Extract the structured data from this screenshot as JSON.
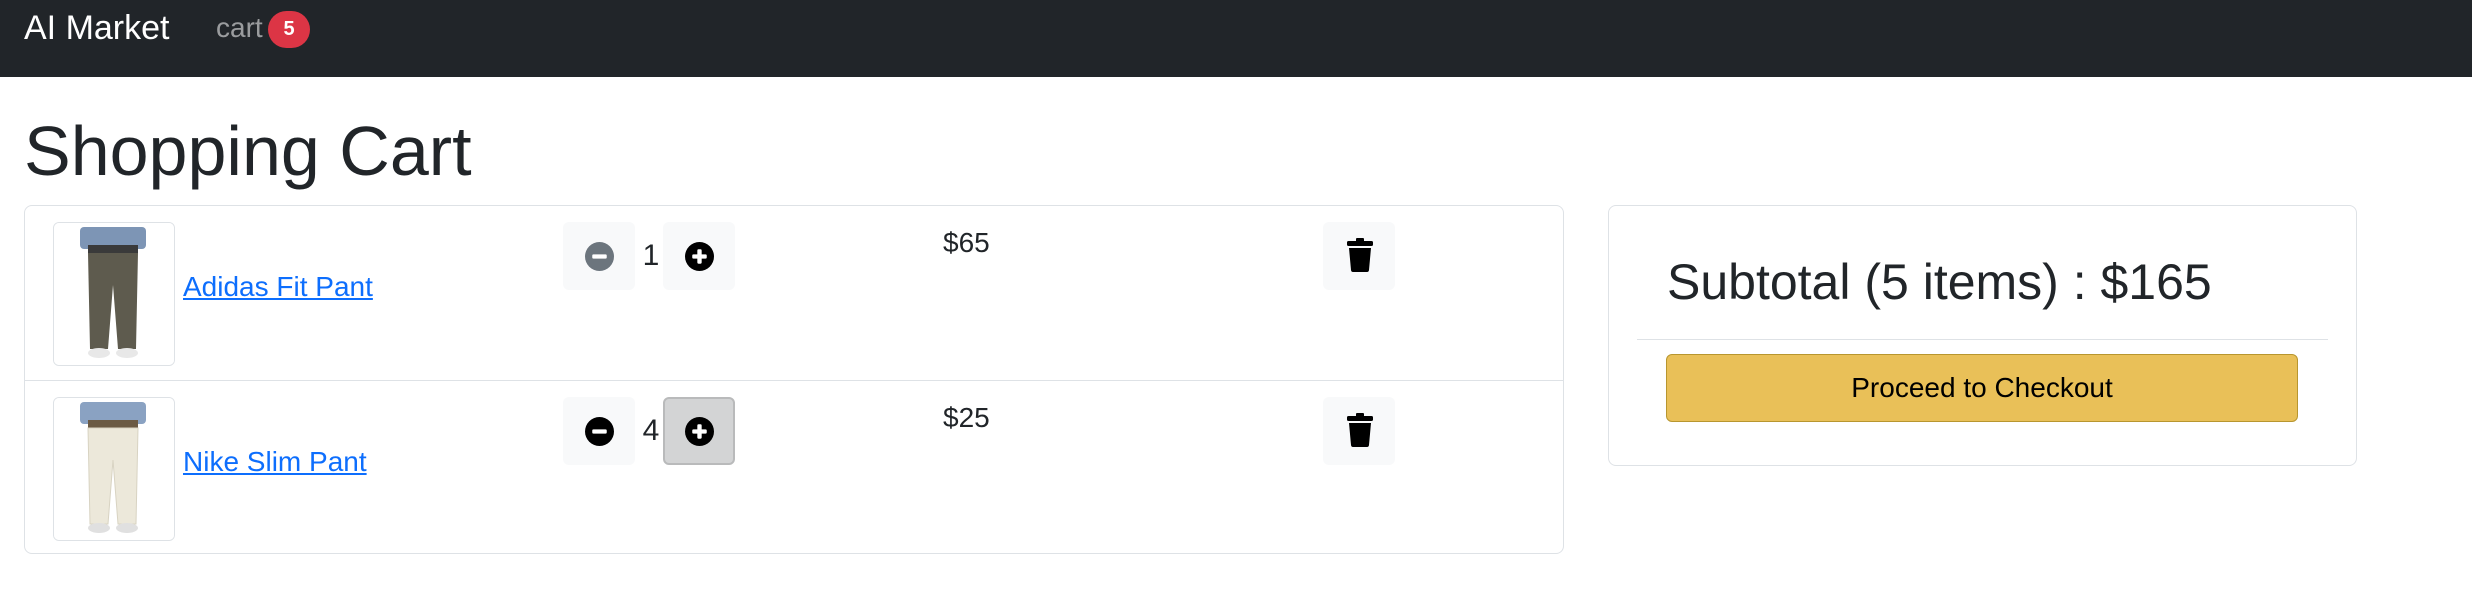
{
  "navbar": {
    "brand": "AI Market",
    "cart_link": "cart",
    "cart_count": "5"
  },
  "page": {
    "title": "Shopping Cart"
  },
  "cart": {
    "items": [
      {
        "name": "Adidas Fit Pant",
        "quantity": "1",
        "price": "$65",
        "pant_color": "#5e5b4e",
        "image_icon": "dark-olive-pants-photo"
      },
      {
        "name": "Nike Slim Pant",
        "quantity": "4",
        "price": "$25",
        "pant_color": "#ece8da",
        "image_icon": "cream-pants-photo"
      }
    ]
  },
  "summary": {
    "subtotal": "Subtotal (5 items) : $165",
    "checkout_label": "Proceed to Checkout"
  },
  "colors": {
    "navbar_bg": "#212529",
    "badge": "#dc3545",
    "link": "#0d6efd",
    "checkout_bg": "#e9c058"
  },
  "icons": {
    "decrease": "minus-circle-icon",
    "increase": "plus-circle-icon",
    "delete": "trash-icon"
  }
}
